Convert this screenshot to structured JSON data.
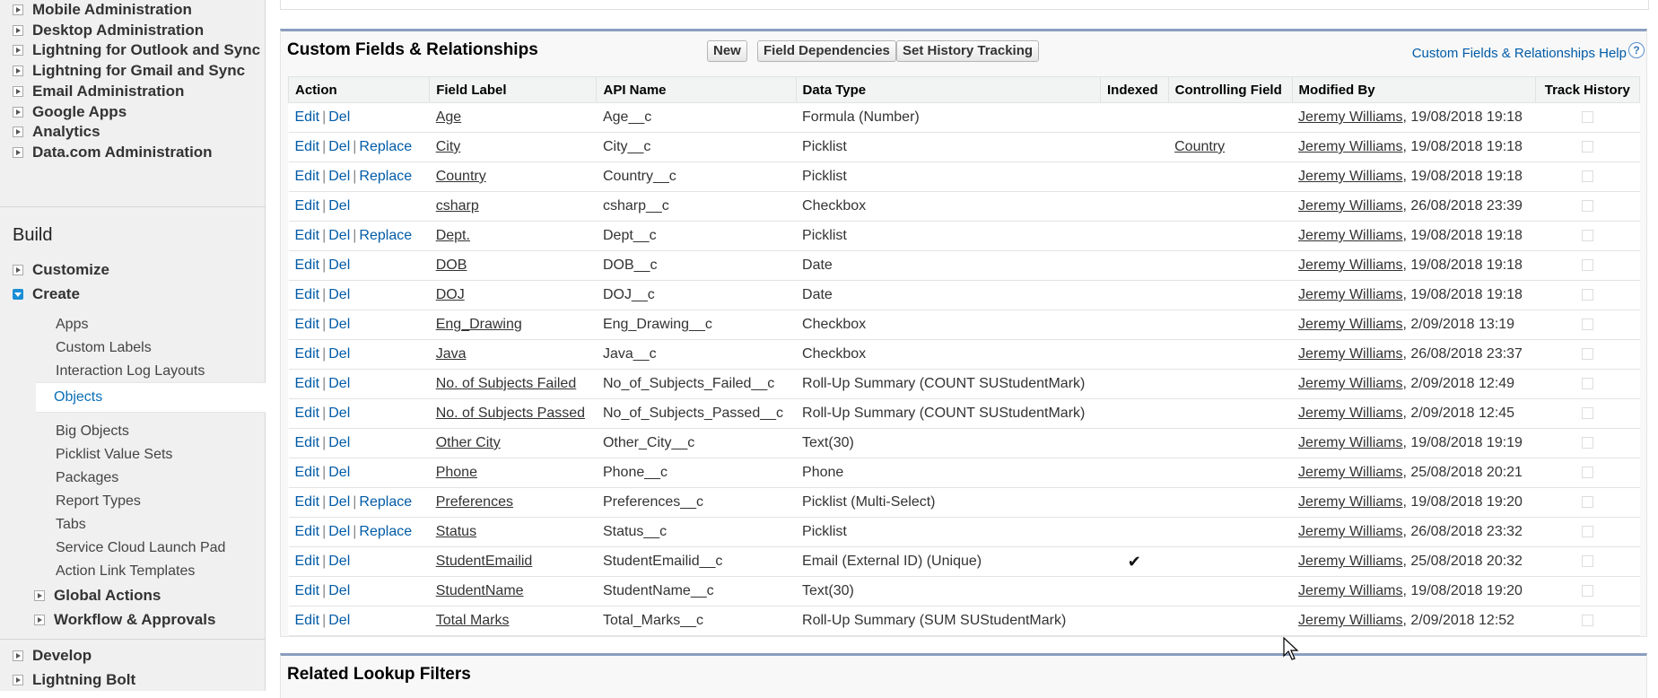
{
  "sidebar": {
    "admin_items": [
      "Mobile Administration",
      "Desktop Administration",
      "Lightning for Outlook and Sync",
      "Lightning for Gmail and Sync",
      "Email Administration",
      "Google Apps",
      "Analytics",
      "Data.com Administration"
    ],
    "build_heading": "Build",
    "customize": "Customize",
    "create": "Create",
    "create_items": [
      "Apps",
      "Custom Labels",
      "Interaction Log Layouts",
      "Objects",
      "Big Objects",
      "Picklist Value Sets",
      "Packages",
      "Report Types",
      "Tabs",
      "Service Cloud Launch Pad",
      "Action Link Templates"
    ],
    "global_actions": "Global Actions",
    "workflow": "Workflow & Approvals",
    "develop": "Develop",
    "lightning_bolt": "Lightning Bolt"
  },
  "section": {
    "title": "Custom Fields & Relationships",
    "btn_new": "New",
    "btn_field_dependencies": "Field Dependencies",
    "btn_history": "Set History Tracking",
    "help_link": "Custom Fields & Relationships Help",
    "help_icon": "?"
  },
  "table": {
    "headers": [
      "Action",
      "Field Label",
      "API Name",
      "Data Type",
      "Indexed",
      "Controlling Field",
      "Modified By",
      "Track History"
    ],
    "action_edit": "Edit",
    "action_del": "Del",
    "action_replace": "Replace",
    "action_sep": "|",
    "rows": [
      {
        "label": "Age",
        "api": "Age__c",
        "type": "Formula (Number)",
        "indexed": "",
        "controlling": "",
        "user": "Jeremy Williams",
        "date": ", 19/08/2018 19:18",
        "replace": false
      },
      {
        "label": "City",
        "api": "City__c",
        "type": "Picklist",
        "indexed": "",
        "controlling": "Country",
        "user": "Jeremy Williams",
        "date": ", 19/08/2018 19:18",
        "replace": true
      },
      {
        "label": "Country",
        "api": "Country__c",
        "type": "Picklist",
        "indexed": "",
        "controlling": "",
        "user": "Jeremy Williams",
        "date": ", 19/08/2018 19:18",
        "replace": true
      },
      {
        "label": "csharp",
        "api": "csharp__c",
        "type": "Checkbox",
        "indexed": "",
        "controlling": "",
        "user": "Jeremy Williams",
        "date": ", 26/08/2018 23:39",
        "replace": false
      },
      {
        "label": "Dept.",
        "api": "Dept__c",
        "type": "Picklist",
        "indexed": "",
        "controlling": "",
        "user": "Jeremy Williams",
        "date": ", 19/08/2018 19:18",
        "replace": true
      },
      {
        "label": "DOB",
        "api": "DOB__c",
        "type": "Date",
        "indexed": "",
        "controlling": "",
        "user": "Jeremy Williams",
        "date": ", 19/08/2018 19:18",
        "replace": false
      },
      {
        "label": "DOJ",
        "api": "DOJ__c",
        "type": "Date",
        "indexed": "",
        "controlling": "",
        "user": "Jeremy Williams",
        "date": ", 19/08/2018 19:18",
        "replace": false
      },
      {
        "label": "Eng_Drawing",
        "api": "Eng_Drawing__c",
        "type": "Checkbox",
        "indexed": "",
        "controlling": "",
        "user": "Jeremy Williams",
        "date": ", 2/09/2018 13:19",
        "replace": false
      },
      {
        "label": "Java",
        "api": "Java__c",
        "type": "Checkbox",
        "indexed": "",
        "controlling": "",
        "user": "Jeremy Williams",
        "date": ", 26/08/2018 23:37",
        "replace": false
      },
      {
        "label": "No. of Subjects Failed",
        "api": "No_of_Subjects_Failed__c",
        "type": "Roll-Up Summary (COUNT SUStudentMark)",
        "indexed": "",
        "controlling": "",
        "user": "Jeremy Williams",
        "date": ", 2/09/2018 12:49",
        "replace": false
      },
      {
        "label": "No. of Subjects Passed",
        "api": "No_of_Subjects_Passed__c",
        "type": "Roll-Up Summary (COUNT SUStudentMark)",
        "indexed": "",
        "controlling": "",
        "user": "Jeremy Williams",
        "date": ", 2/09/2018 12:45",
        "replace": false
      },
      {
        "label": "Other City",
        "api": "Other_City__c",
        "type": "Text(30)",
        "indexed": "",
        "controlling": "",
        "user": "Jeremy Williams",
        "date": ", 19/08/2018 19:19",
        "replace": false
      },
      {
        "label": "Phone",
        "api": "Phone__c",
        "type": "Phone",
        "indexed": "",
        "controlling": "",
        "user": "Jeremy Williams",
        "date": ", 25/08/2018 20:21",
        "replace": false
      },
      {
        "label": "Preferences",
        "api": "Preferences__c",
        "type": "Picklist (Multi-Select)",
        "indexed": "",
        "controlling": "",
        "user": "Jeremy Williams",
        "date": ", 19/08/2018 19:20",
        "replace": true
      },
      {
        "label": "Status",
        "api": "Status__c",
        "type": "Picklist",
        "indexed": "",
        "controlling": "",
        "user": "Jeremy Williams",
        "date": ", 26/08/2018 23:32",
        "replace": true
      },
      {
        "label": "StudentEmailid",
        "api": "StudentEmailid__c",
        "type": "Email (External ID) (Unique)",
        "indexed": "✔",
        "controlling": "",
        "user": "Jeremy Williams",
        "date": ", 25/08/2018 20:32",
        "replace": false
      },
      {
        "label": "StudentName",
        "api": "StudentName__c",
        "type": "Text(30)",
        "indexed": "",
        "controlling": "",
        "user": "Jeremy Williams",
        "date": ", 19/08/2018 19:20",
        "replace": false
      },
      {
        "label": "Total Marks",
        "api": "Total_Marks__c",
        "type": "Roll-Up Summary (SUM SUStudentMark)",
        "indexed": "",
        "controlling": "",
        "user": "Jeremy Williams",
        "date": ", 2/09/2018 12:52",
        "replace": false
      }
    ]
  },
  "related": {
    "title": "Related Lookup Filters"
  },
  "colors": {
    "link": "#015ba7",
    "panel_border": "#8a9ebe",
    "selected_expander": "#1a8ed6"
  }
}
